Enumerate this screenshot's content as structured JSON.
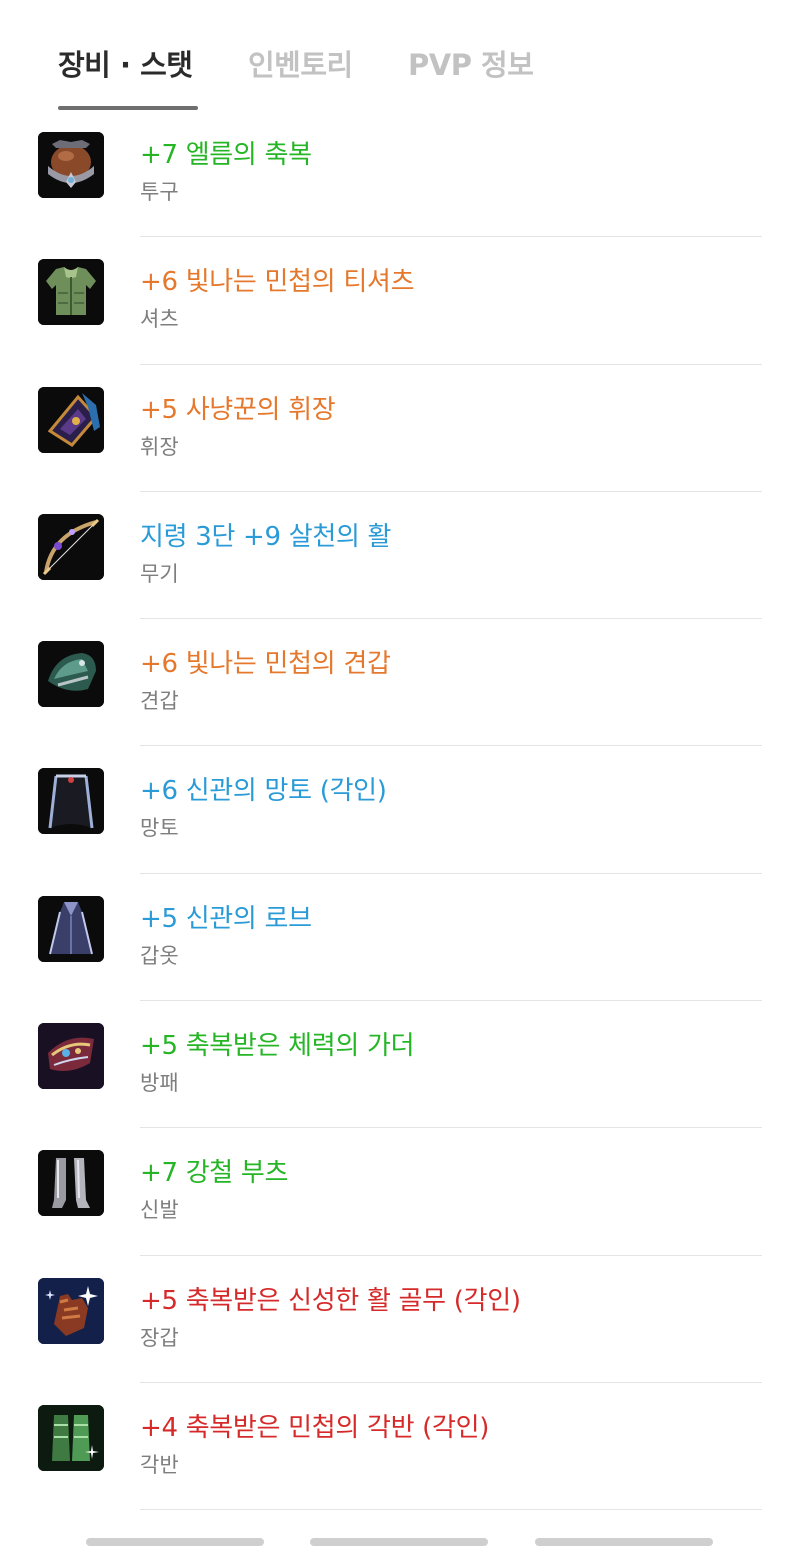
{
  "tabs": [
    {
      "label": "장비 · 스탯",
      "active": true
    },
    {
      "label": "인벤토리",
      "active": false
    },
    {
      "label": "PVP 정보",
      "active": false
    }
  ],
  "items": [
    {
      "name": "+7  엘름의 축복",
      "slot": "투구",
      "grade": "green",
      "icon": "helmet-icon"
    },
    {
      "name": "+6  빛나는 민첩의 티셔츠",
      "slot": "셔츠",
      "grade": "orange",
      "icon": "shirt-icon"
    },
    {
      "name": "+5  사냥꾼의 휘장",
      "slot": "휘장",
      "grade": "orange",
      "icon": "insignia-icon"
    },
    {
      "name": "지령 3단 +9  살천의 활",
      "slot": "무기",
      "grade": "blue",
      "icon": "bow-icon"
    },
    {
      "name": "+6  빛나는 민첩의 견갑",
      "slot": "견갑",
      "grade": "orange",
      "icon": "shoulder-guard-icon"
    },
    {
      "name": "+6  신관의 망토 (각인)",
      "slot": "망토",
      "grade": "blue",
      "icon": "cloak-icon"
    },
    {
      "name": "+5  신관의 로브",
      "slot": "갑옷",
      "grade": "blue",
      "icon": "robe-icon"
    },
    {
      "name": "+5  축복받은 체력의 가더",
      "slot": "방패",
      "grade": "green",
      "icon": "guarder-icon"
    },
    {
      "name": "+7  강철 부츠",
      "slot": "신발",
      "grade": "green",
      "icon": "boots-icon"
    },
    {
      "name": "+5  축복받은 신성한 활 골무 (각인)",
      "slot": "장갑",
      "grade": "red",
      "icon": "glove-icon"
    },
    {
      "name": "+4  축복받은 민첩의 각반 (각인)",
      "slot": "각반",
      "grade": "red",
      "icon": "greaves-icon"
    }
  ],
  "grade_colors": {
    "green": "#25b525",
    "orange": "#e5782c",
    "blue": "#2a9bd6",
    "red": "#d62a2a"
  },
  "pager": {
    "pages": 3
  }
}
